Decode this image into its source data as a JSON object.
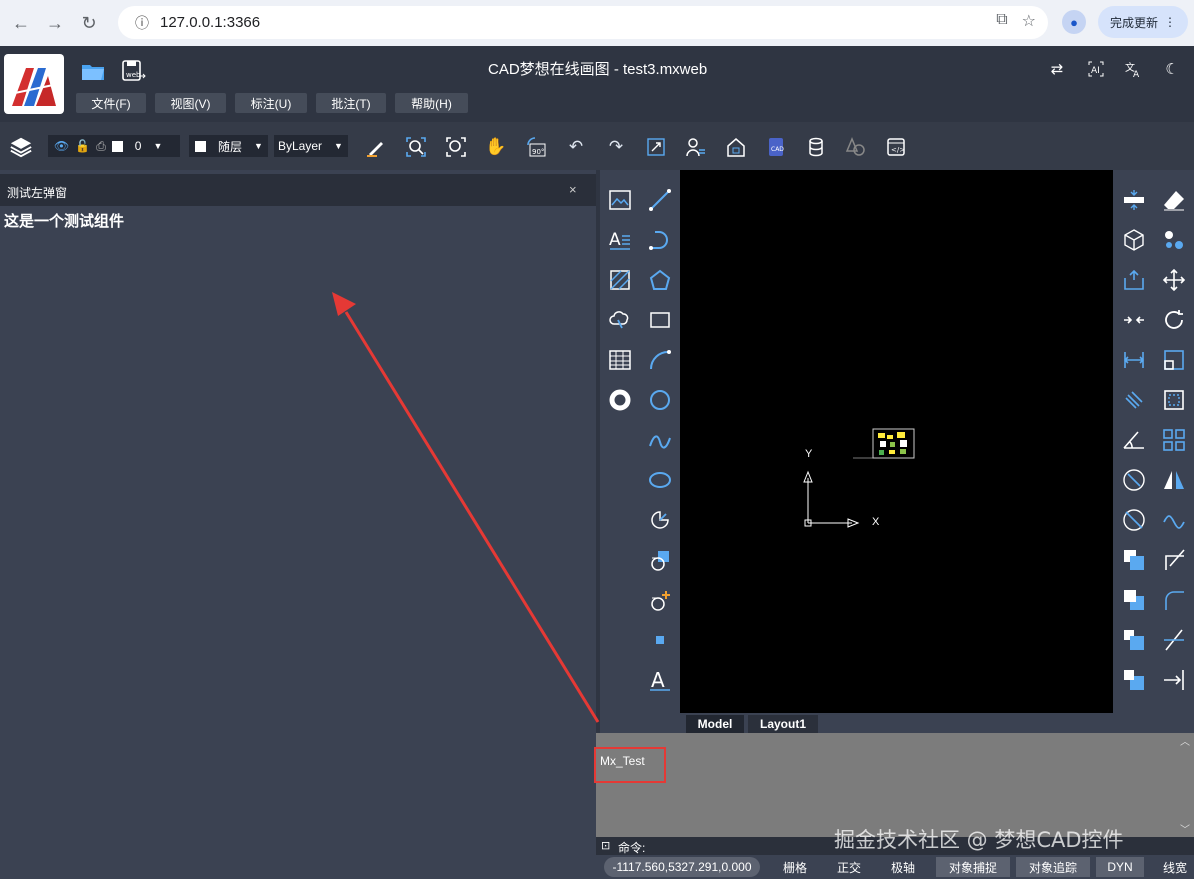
{
  "browser": {
    "url": "127.0.0.1:3366",
    "update_label": "完成更新",
    "update_menu": "⋮"
  },
  "app": {
    "title": "CAD梦想在线画图 - test3.mxweb",
    "menus": [
      "文件(F)",
      "视图(V)",
      "标注(U)",
      "批注(T)",
      "帮助(H)"
    ]
  },
  "toolbar": {
    "layer_value": "0",
    "color_value": "随层",
    "linetype_value": "ByLayer"
  },
  "left_panel": {
    "title": "测试左弹窗",
    "close": "×",
    "content": "这是一个测试组件"
  },
  "canvas": {
    "axis_x": "X",
    "axis_y": "Y",
    "tabs": [
      "Model",
      "Layout1"
    ]
  },
  "command": {
    "history_text": "Mx_Test",
    "prompt": "命令:",
    "coordinates": "-1117.560,5327.291,0.000"
  },
  "status": {
    "items": [
      "栅格",
      "正交",
      "极轴",
      "对象捕捉",
      "对象追踪",
      "DYN",
      "线宽"
    ],
    "active": [
      "对象捕捉",
      "对象追踪",
      "DYN"
    ]
  },
  "watermark": "掘金技术社区 @ 梦想CAD控件",
  "colors": {
    "app_bg": "#2f3542",
    "panel_bg": "#3b4252",
    "canvas_bg": "#000000",
    "accent_blue": "#5aa9f0",
    "annotation_red": "#e53935"
  }
}
